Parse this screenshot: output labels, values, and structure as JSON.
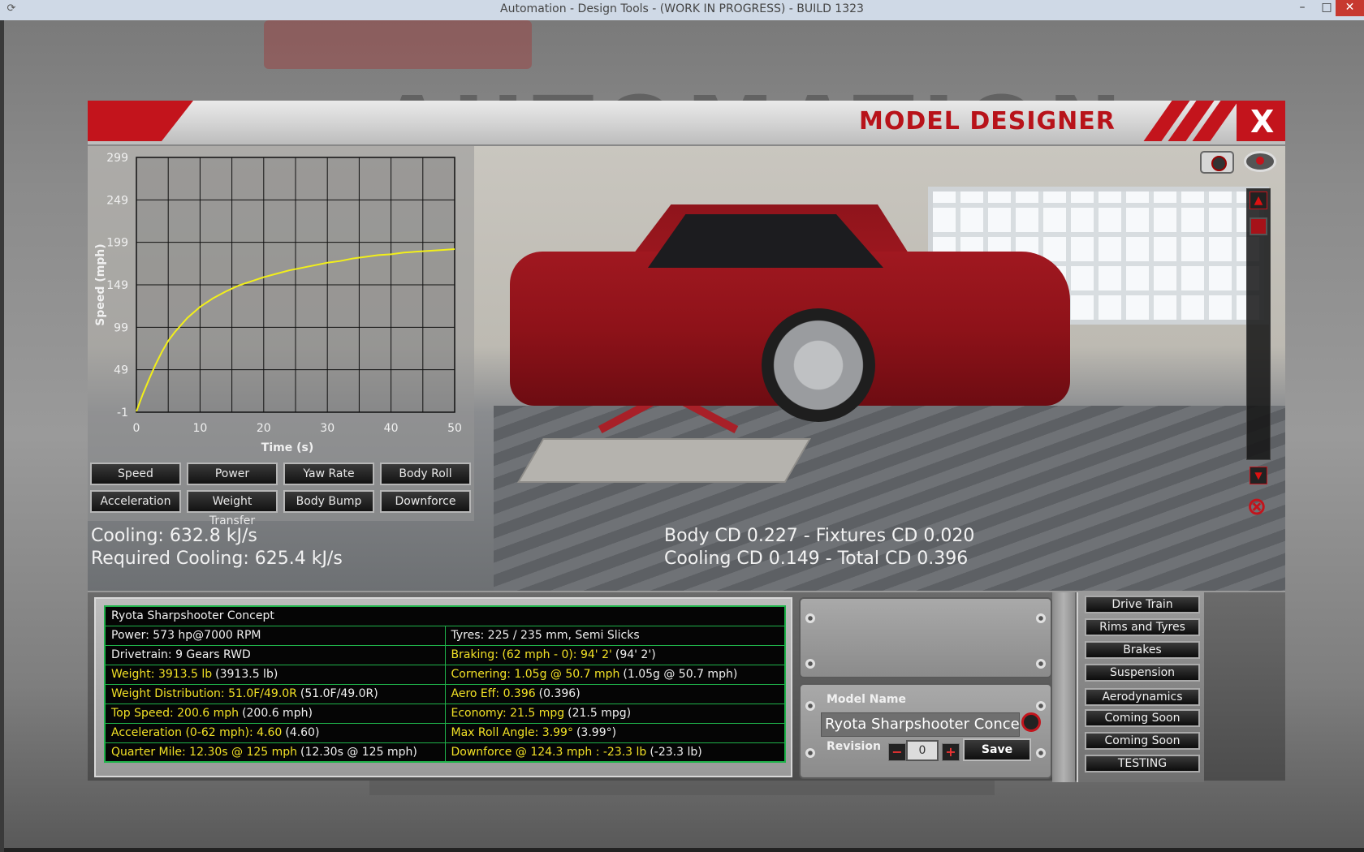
{
  "window": {
    "title": "Automation - Design Tools - (WORK IN PROGRESS) - BUILD 1323"
  },
  "background": {
    "logo_text": "AUTOMATION"
  },
  "panel": {
    "title": "MODEL DESIGNER",
    "close_label": "X"
  },
  "chart_data": {
    "type": "line",
    "title": "",
    "xlabel": "Time (s)",
    "ylabel": "Speed (mph)",
    "xlim": [
      0,
      50
    ],
    "ylim": [
      -1,
      299
    ],
    "x_ticks": [
      "0",
      "10",
      "20",
      "30",
      "40",
      "50"
    ],
    "y_ticks": [
      "299",
      "249",
      "199",
      "149",
      "99",
      "49",
      "-1"
    ],
    "grid": true,
    "series": [
      {
        "color": "#f2ef1a",
        "x": [
          0,
          1,
          2,
          3,
          4,
          5,
          6,
          8,
          10,
          12,
          14,
          16,
          18,
          20,
          22,
          24,
          26,
          28,
          30,
          32,
          34,
          36,
          38,
          40,
          42,
          44,
          46,
          48,
          50
        ],
        "y": [
          0,
          20,
          38,
          55,
          70,
          83,
          93,
          110,
          123,
          133,
          141,
          148,
          153,
          158,
          162,
          166,
          169,
          172,
          175,
          177,
          180,
          182,
          184,
          185,
          187,
          188,
          189,
          190,
          191
        ]
      }
    ]
  },
  "chart_buttons": [
    "Speed",
    "Power",
    "Yaw Rate",
    "Body Roll",
    "Acceleration",
    "Weight Transfer",
    "Body Bump",
    "Downforce"
  ],
  "readouts": {
    "cooling": "Cooling: 632.8 kJ/s",
    "required_cooling": "Required Cooling: 625.4 kJ/s",
    "body_cd": "Body CD 0.227 - Fixtures CD 0.020",
    "cooling_cd": "Cooling CD 0.149 - Total CD 0.396"
  },
  "stats": {
    "model": "Ryota Sharpshooter Concept",
    "rows": [
      {
        "left": "Power: 573 hp@7000 RPM",
        "left_extra": "",
        "left_yellow": false,
        "right": "Tyres: 225 / 235 mm, Semi Slicks",
        "right_extra": "",
        "right_yellow": false
      },
      {
        "left": "Drivetrain: 9 Gears RWD",
        "left_extra": "",
        "left_yellow": false,
        "right": "Braking: (62 mph - 0): 94' 2'",
        "right_extra": "(94' 2')",
        "right_yellow": true
      },
      {
        "left": "Weight: 3913.5 lb",
        "left_extra": "(3913.5 lb)",
        "left_yellow": true,
        "right": "Cornering: 1.05g @ 50.7 mph",
        "right_extra": "(1.05g @ 50.7 mph)",
        "right_yellow": true
      },
      {
        "left": "Weight Distribution: 51.0F/49.0R",
        "left_extra": "(51.0F/49.0R)",
        "left_yellow": true,
        "right": "Aero Eff: 0.396",
        "right_extra": "(0.396)",
        "right_yellow": true
      },
      {
        "left": "Top Speed: 200.6 mph",
        "left_extra": "(200.6 mph)",
        "left_yellow": true,
        "right": "Economy: 21.5 mpg",
        "right_extra": "(21.5 mpg)",
        "right_yellow": true
      },
      {
        "left": "Acceleration (0-62 mph): 4.60",
        "left_extra": "(4.60)",
        "left_yellow": true,
        "right": "Max Roll Angle: 3.99°",
        "right_extra": "(3.99°)",
        "right_yellow": true
      },
      {
        "left": "Quarter Mile: 12.30s @ 125 mph",
        "left_extra": "(12.30s @ 125 mph)",
        "left_yellow": true,
        "right": "Downforce @ 124.3 mph : -23.3 lb",
        "right_extra": "(-23.3 lb)",
        "right_yellow": true
      }
    ]
  },
  "model_form": {
    "name_label": "Model Name",
    "name_value": "Ryota Sharpshooter Concept",
    "revision_label": "Revision",
    "revision_value": "0",
    "minus": "−",
    "plus": "+",
    "save_label": "Save"
  },
  "side_menu": [
    "Drive Train",
    "Rims and Tyres",
    "Brakes",
    "Suspension",
    "Aerodynamics",
    "Coming Soon",
    "Coming Soon",
    "TESTING"
  ],
  "icons": {
    "camera": "camera-icon",
    "eye": "eye-icon",
    "scroll_up": "chevron-up-icon",
    "scroll_down": "chevron-down-icon",
    "reset_view": "reset-view-icon"
  },
  "colors": {
    "accent_red": "#c3141c",
    "stat_yellow": "#f2e126",
    "stat_border_green": "#1fb24a"
  }
}
